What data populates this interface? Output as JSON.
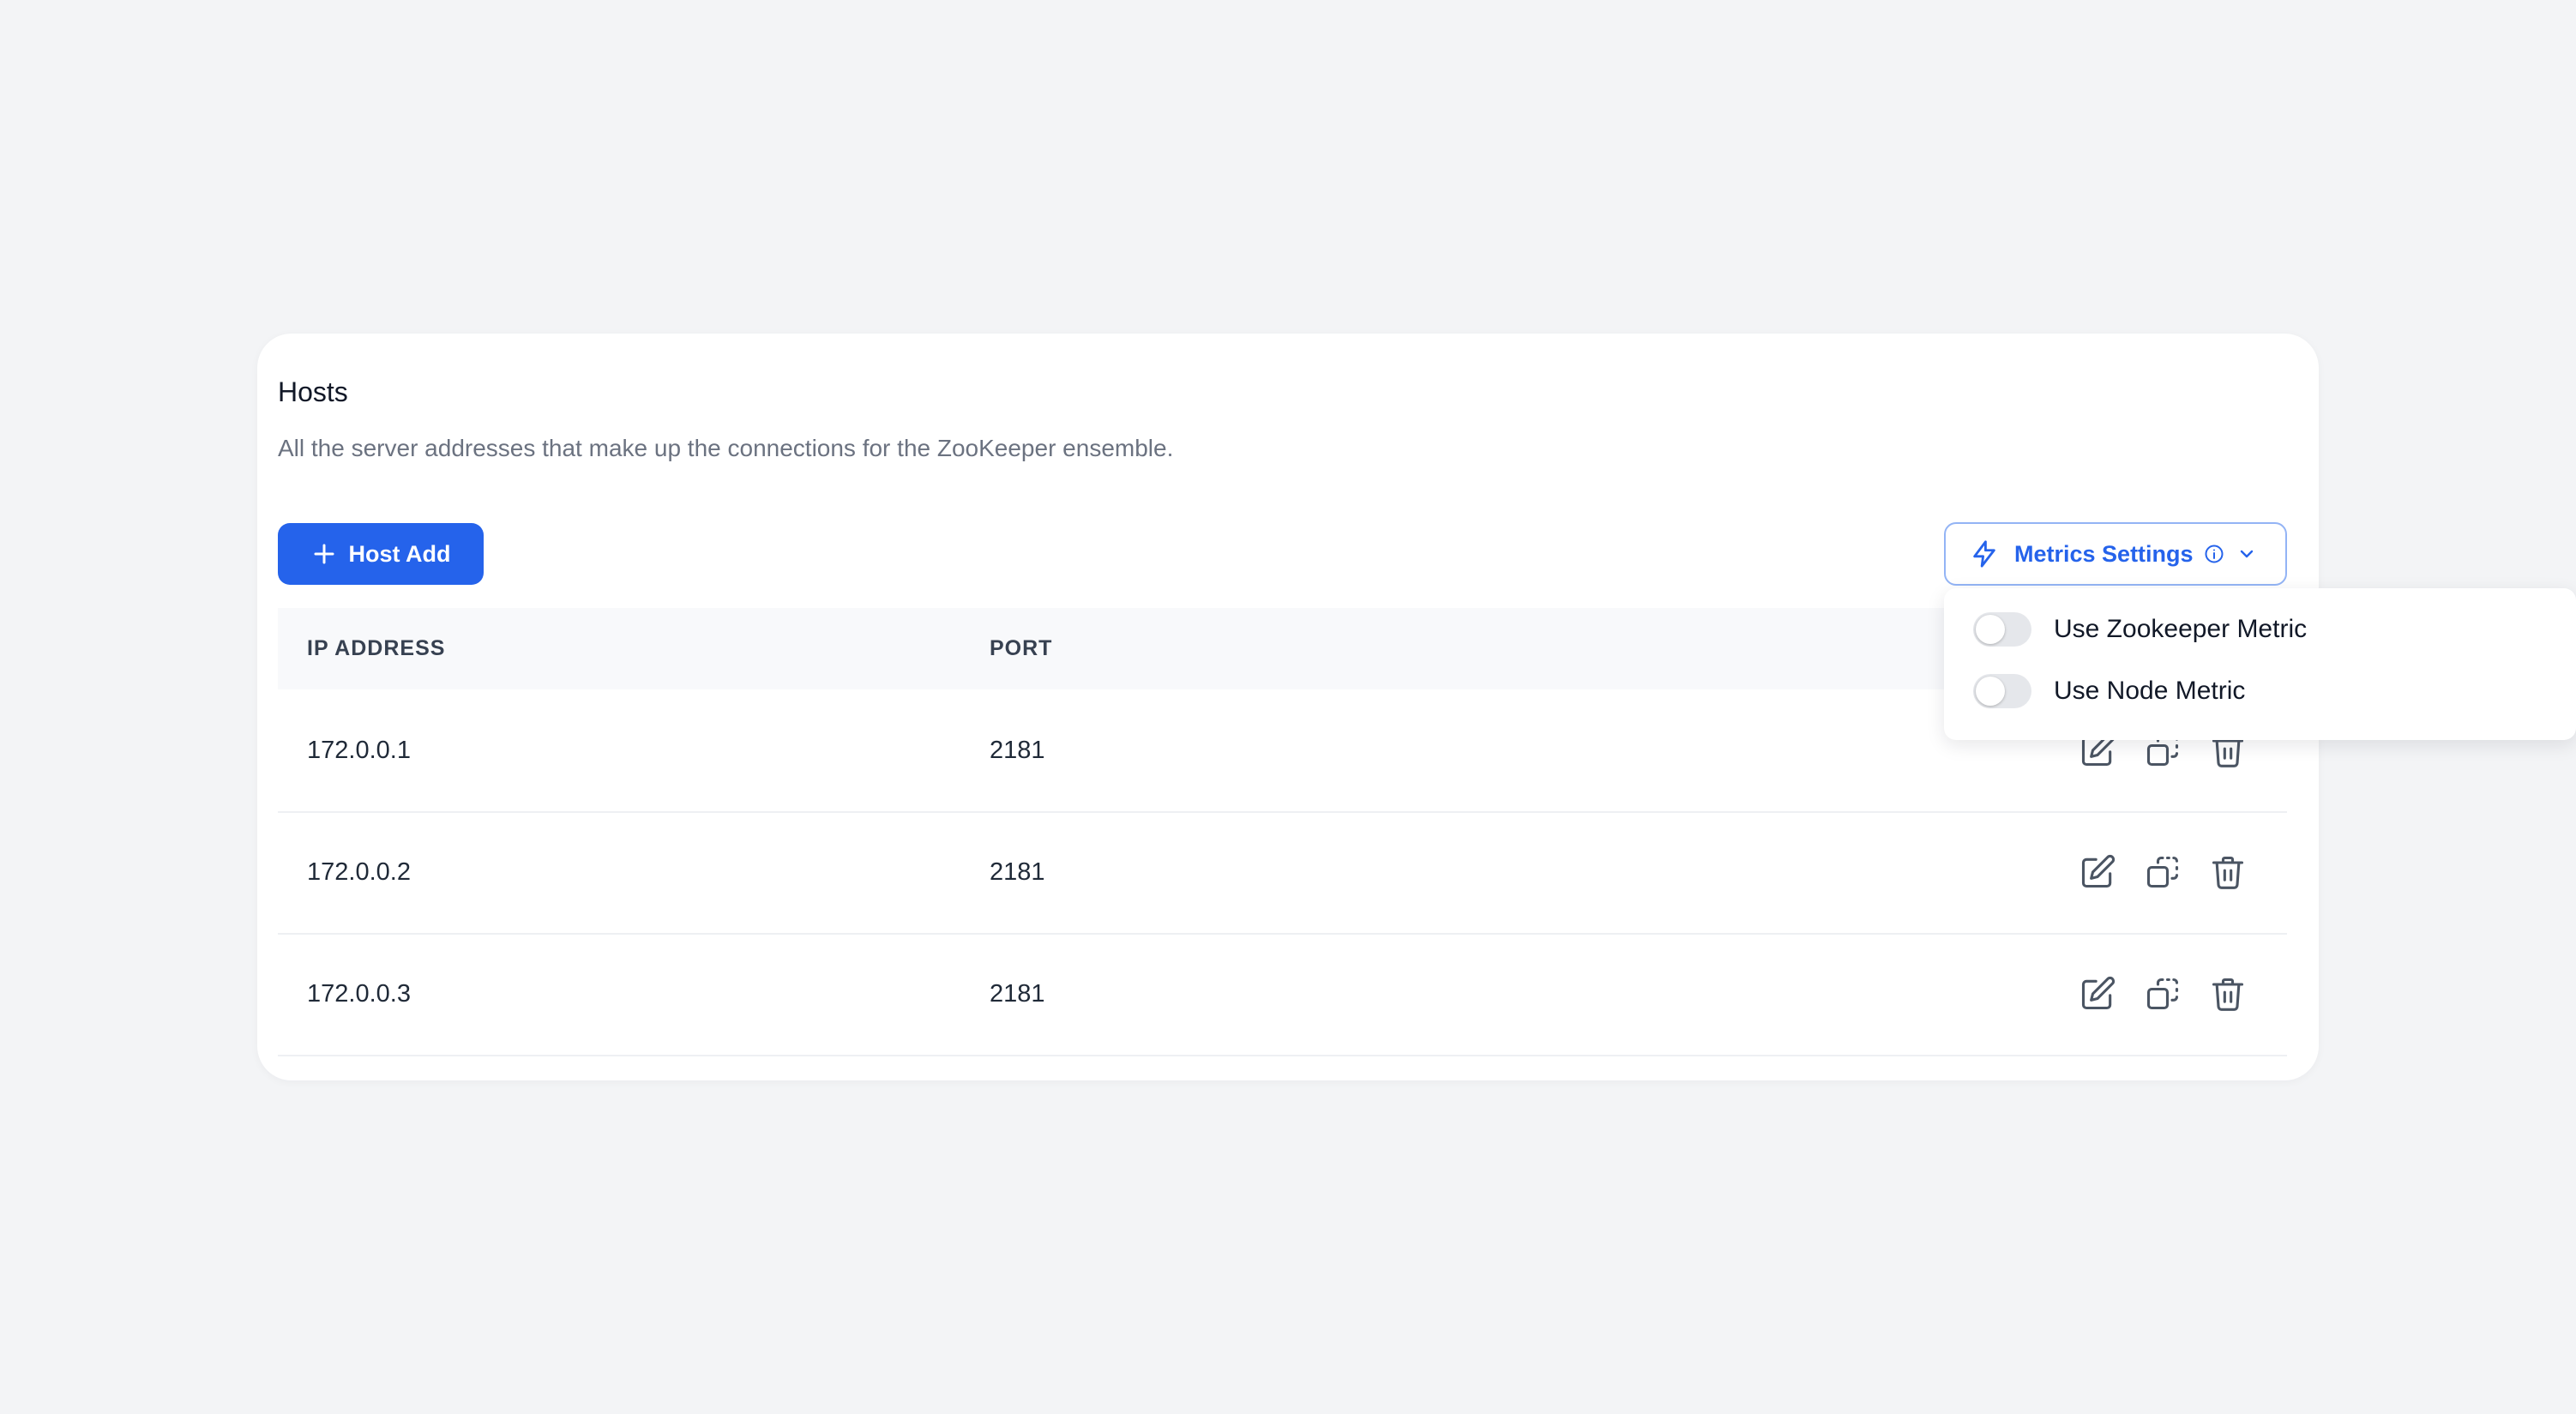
{
  "hosts": {
    "title": "Hosts",
    "description": "All the server addresses that make up the connections for the ZooKeeper ensemble."
  },
  "toolbar": {
    "add_label": "Host Add",
    "metrics_label": "Metrics Settings"
  },
  "table": {
    "columns": [
      "IP ADDRESS",
      "PORT"
    ],
    "rows": [
      {
        "ip": "172.0.0.1",
        "port": "2181"
      },
      {
        "ip": "172.0.0.2",
        "port": "2181"
      },
      {
        "ip": "172.0.0.3",
        "port": "2181"
      }
    ]
  },
  "metrics_menu": {
    "options": [
      {
        "label": "Use Zookeeper Metric",
        "enabled": false
      },
      {
        "label": "Use Node Metric",
        "enabled": false
      }
    ]
  },
  "colors": {
    "accent": "#2563eb",
    "background": "#f3f4f6",
    "card": "#ffffff",
    "icon": "#4b5563"
  },
  "icons": {
    "add": "plus-icon",
    "metrics": "lightning-icon",
    "info": "info-icon",
    "dropdown": "chevron-down-icon",
    "edit": "edit-icon",
    "duplicate": "duplicate-icon",
    "delete": "trash-icon"
  }
}
